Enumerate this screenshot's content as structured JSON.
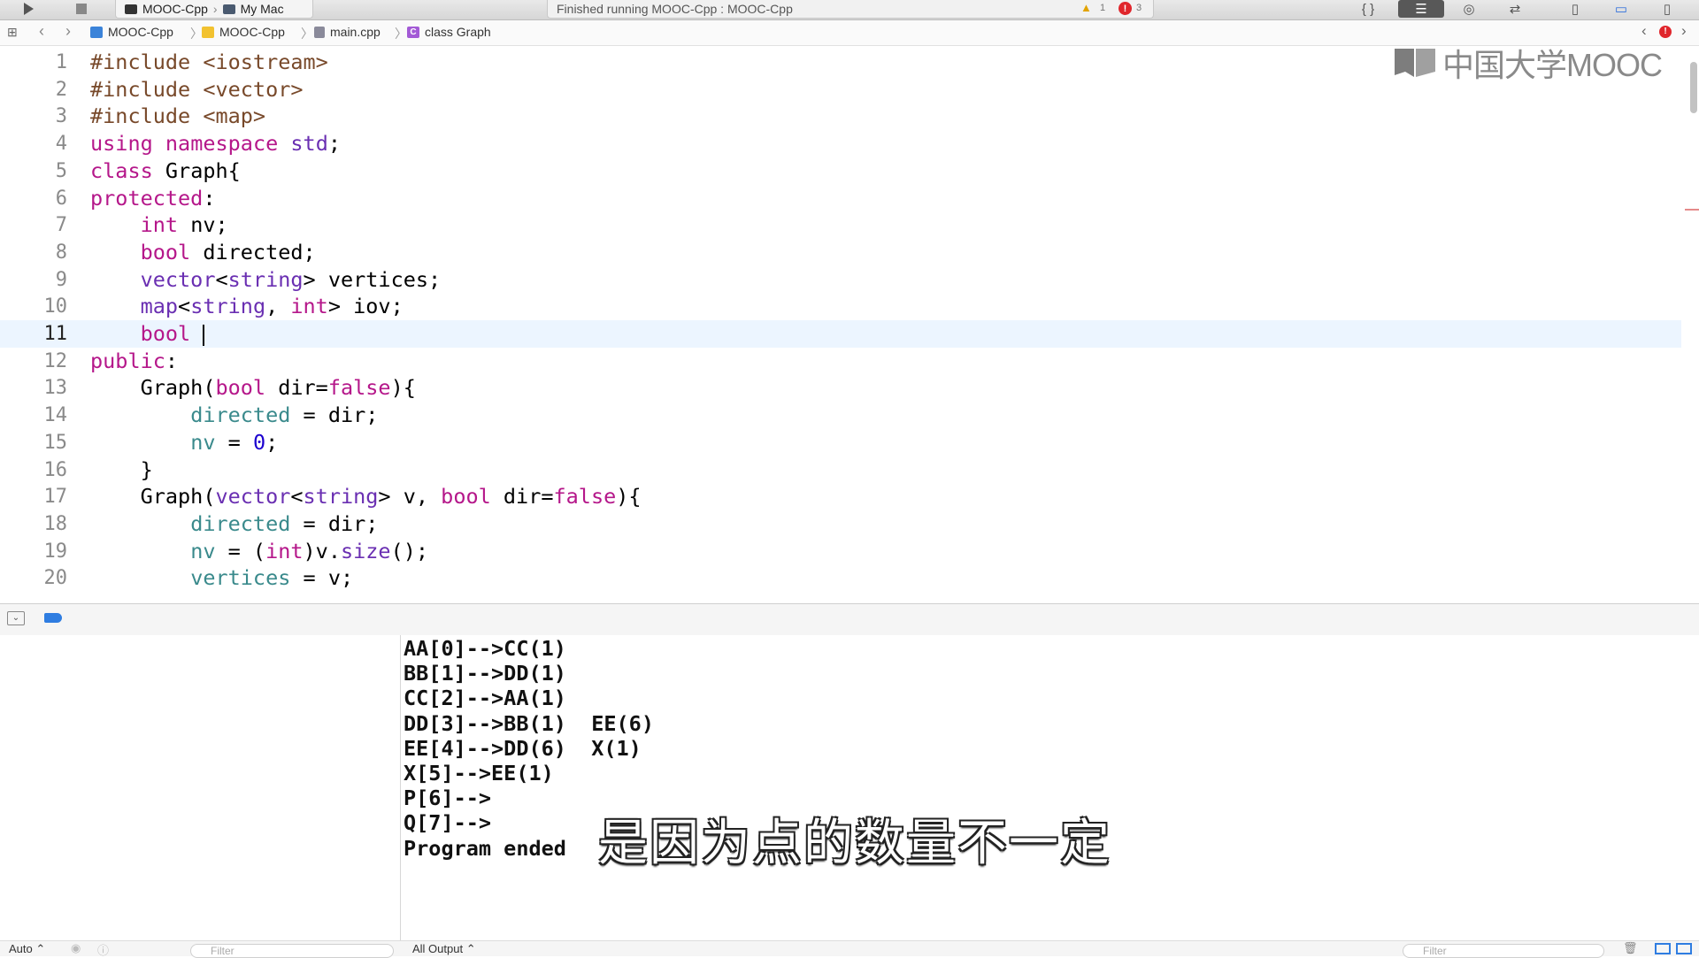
{
  "toolbar": {
    "scheme_project": "MOOC-Cpp",
    "scheme_destination": "My Mac",
    "status_text": "Finished running MOOC-Cpp : MOOC-Cpp",
    "warning_count": "1",
    "error_count": "3"
  },
  "jumpbar": {
    "items": [
      "MOOC-Cpp",
      "MOOC-Cpp",
      "main.cpp",
      "class Graph"
    ],
    "class_icon_letter": "C"
  },
  "watermark": {
    "text": "中国大学MOOC"
  },
  "editor": {
    "current_line": 11,
    "lines": [
      {
        "num": "1"
      },
      {
        "num": "2"
      },
      {
        "num": "3"
      },
      {
        "num": "4"
      },
      {
        "num": "5"
      },
      {
        "num": "6"
      },
      {
        "num": "7"
      },
      {
        "num": "8"
      },
      {
        "num": "9"
      },
      {
        "num": "10"
      },
      {
        "num": "11"
      },
      {
        "num": "12"
      },
      {
        "num": "13"
      },
      {
        "num": "14"
      },
      {
        "num": "15"
      },
      {
        "num": "16"
      },
      {
        "num": "17"
      },
      {
        "num": "18"
      },
      {
        "num": "19"
      },
      {
        "num": "20"
      }
    ],
    "code": [
      [
        [
          "pp",
          "#include <iostream>"
        ]
      ],
      [
        [
          "pp",
          "#include <vector>"
        ]
      ],
      [
        [
          "pp",
          "#include <map>"
        ]
      ],
      [
        [
          "kw",
          "using"
        ],
        [
          "pl",
          " "
        ],
        [
          "kw",
          "namespace"
        ],
        [
          "pl",
          " "
        ],
        [
          "ty",
          "std"
        ],
        [
          "pl",
          ";"
        ]
      ],
      [
        [
          "kw",
          "class"
        ],
        [
          "pl",
          " Graph{"
        ]
      ],
      [
        [
          "kw",
          "protected"
        ],
        [
          "pl",
          ":"
        ]
      ],
      [
        [
          "pl",
          "    "
        ],
        [
          "kw",
          "int"
        ],
        [
          "pl",
          " nv;"
        ]
      ],
      [
        [
          "pl",
          "    "
        ],
        [
          "kw",
          "bool"
        ],
        [
          "pl",
          " directed;"
        ]
      ],
      [
        [
          "pl",
          "    "
        ],
        [
          "ty",
          "vector"
        ],
        [
          "pl",
          "<"
        ],
        [
          "ty",
          "string"
        ],
        [
          "pl",
          "> vertices;"
        ]
      ],
      [
        [
          "pl",
          "    "
        ],
        [
          "ty",
          "map"
        ],
        [
          "pl",
          "<"
        ],
        [
          "ty",
          "string"
        ],
        [
          "pl",
          ", "
        ],
        [
          "kw",
          "int"
        ],
        [
          "pl",
          "> iov;"
        ]
      ],
      [
        [
          "pl",
          "    "
        ],
        [
          "kw",
          "bool"
        ],
        [
          "pl",
          " "
        ]
      ],
      [
        [
          "kw",
          "public"
        ],
        [
          "pl",
          ":"
        ]
      ],
      [
        [
          "pl",
          "    Graph("
        ],
        [
          "kw",
          "bool"
        ],
        [
          "pl",
          " dir="
        ],
        [
          "kw",
          "false"
        ],
        [
          "pl",
          "){"
        ]
      ],
      [
        [
          "pl",
          "        "
        ],
        [
          "mem",
          "directed"
        ],
        [
          "pl",
          " = dir;"
        ]
      ],
      [
        [
          "pl",
          "        "
        ],
        [
          "mem",
          "nv"
        ],
        [
          "pl",
          " = "
        ],
        [
          "num",
          "0"
        ],
        [
          "pl",
          ";"
        ]
      ],
      [
        [
          "pl",
          "    }"
        ]
      ],
      [
        [
          "pl",
          "    Graph("
        ],
        [
          "ty",
          "vector"
        ],
        [
          "pl",
          "<"
        ],
        [
          "ty",
          "string"
        ],
        [
          "pl",
          "> v, "
        ],
        [
          "kw",
          "bool"
        ],
        [
          "pl",
          " dir="
        ],
        [
          "kw",
          "false"
        ],
        [
          "pl",
          "){"
        ]
      ],
      [
        [
          "pl",
          "        "
        ],
        [
          "mem",
          "directed"
        ],
        [
          "pl",
          " = dir;"
        ]
      ],
      [
        [
          "pl",
          "        "
        ],
        [
          "mem",
          "nv"
        ],
        [
          "pl",
          " = ("
        ],
        [
          "kw",
          "int"
        ],
        [
          "pl",
          ")v."
        ],
        [
          "ty",
          "size"
        ],
        [
          "pl",
          "();"
        ]
      ],
      [
        [
          "pl",
          "        "
        ],
        [
          "mem",
          "vertices"
        ],
        [
          "pl",
          " = v;"
        ]
      ]
    ]
  },
  "console": {
    "lines": [
      "AA[0]-->CC(1)",
      "BB[1]-->DD(1)",
      "CC[2]-->AA(1)",
      "DD[3]-->BB(1)  EE(6)",
      "EE[4]-->DD(6)  X(1)",
      "X[5]-->EE(1)",
      "P[6]-->",
      "Q[7]-->",
      "Program ended"
    ]
  },
  "subtitle": "是因为点的数量不一定",
  "bottombar": {
    "auto_label": "Auto ⌃",
    "filter_placeholder": "Filter",
    "output_label": "All Output ⌃",
    "filter_right_placeholder": "Filter"
  },
  "colors": {
    "keyword": "#b5178a",
    "preprocessor": "#78492a",
    "type": "#6a2fb2",
    "member": "#3a8a8c",
    "number": "#1c00cf",
    "current_line": "#ecf5ff",
    "error_red": "#e0262c"
  }
}
